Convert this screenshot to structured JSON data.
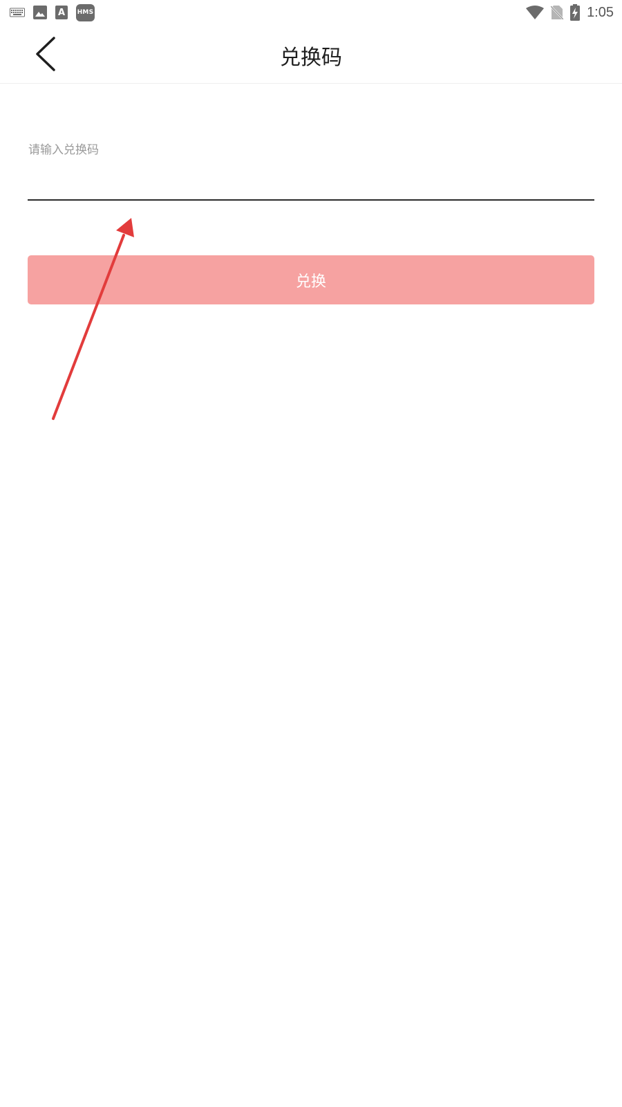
{
  "status_bar": {
    "left_icons": [
      "keyboard-icon",
      "image-icon",
      "font-icon",
      "hms-icon"
    ],
    "hms_label": "HMS",
    "right_icons": [
      "wifi-icon",
      "no-sim-icon",
      "battery-charging-icon"
    ],
    "time": "1:05"
  },
  "header": {
    "back_icon": "chevron-left-icon",
    "title": "兑换码"
  },
  "form": {
    "code_input": {
      "placeholder": "请输入兑换码",
      "value": ""
    },
    "redeem_button": {
      "label": "兑换"
    }
  },
  "colors": {
    "button_background": "#f6a2a1",
    "button_text": "#ffffff",
    "underline": "#2a2a2a",
    "placeholder": "#9a9a9a",
    "annotation_arrow": "#e23c3c"
  }
}
